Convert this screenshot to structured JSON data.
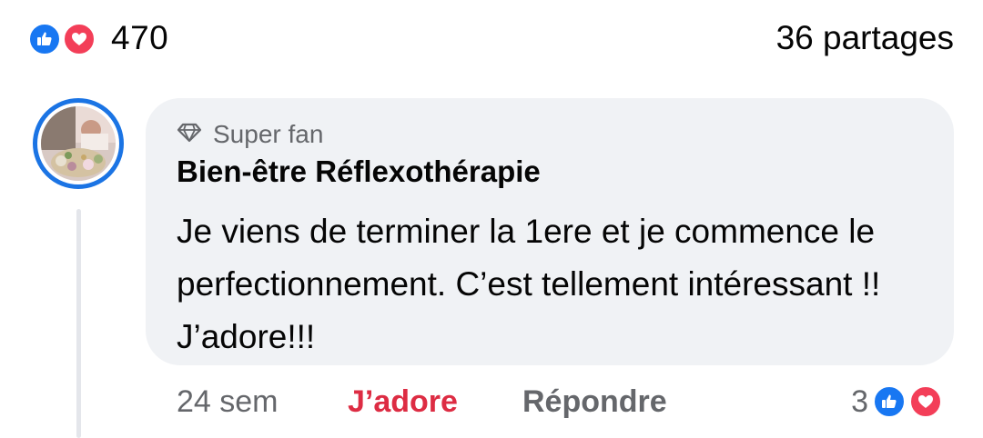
{
  "post_stats": {
    "reaction_count": "470",
    "shares_label": "36 partages",
    "reaction_types": [
      "like-icon",
      "love-icon"
    ]
  },
  "comment": {
    "badge": "Super fan",
    "author": "Bien-être Réflexothérapie",
    "text": "Je viens de terminer la 1ere et je commence le perfectionnement. C’est tellement intéressant !! J’adore!!!",
    "timestamp": "24 sem",
    "love_label": "J’adore",
    "reply_label": "Répondre",
    "reaction_count": "3",
    "reaction_types": [
      "like-icon",
      "love-icon"
    ]
  },
  "colors": {
    "like_blue": "#1877f2",
    "love_red": "#f33e58",
    "active_love_text": "#dd2c43",
    "secondary_text": "#65676b",
    "bubble_bg": "#f0f2f5",
    "avatar_ring": "#1b74e4"
  }
}
